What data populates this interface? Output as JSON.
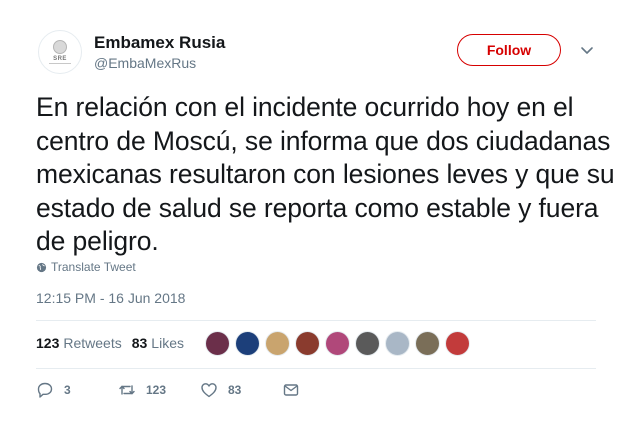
{
  "author": {
    "display_name": "Embamex Rusia",
    "handle": "@EmbaMexRus",
    "avatar_text": "SRE"
  },
  "follow_label": "Follow",
  "tweet_text": "En relación con el incidente ocurrido hoy en el centro de Moscú, se informa que dos ciudadanas mexicanas resultaron con lesiones leves y que su estado de salud se reporta como estable y fuera de peligro.",
  "translate_label": "Translate Tweet",
  "timestamp": "12:15 PM - 16 Jun 2018",
  "stats": {
    "retweets_count": "123",
    "retweets_label": "Retweets",
    "likes_count": "83",
    "likes_label": "Likes"
  },
  "liker_avatar_colors": [
    "#6b2f4a",
    "#1c3f7a",
    "#c9a46e",
    "#8a3b2e",
    "#b0487a",
    "#5a5a5a",
    "#a9b7c6",
    "#7a6e58",
    "#c23b3b"
  ],
  "actions": {
    "reply_count": "3",
    "retweet_count": "123",
    "like_count": "83"
  },
  "icons": {
    "chevron": "chevron-down-icon",
    "globe": "globe-icon",
    "reply": "reply-icon",
    "retweet": "retweet-icon",
    "like": "heart-icon",
    "dm": "envelope-icon"
  }
}
